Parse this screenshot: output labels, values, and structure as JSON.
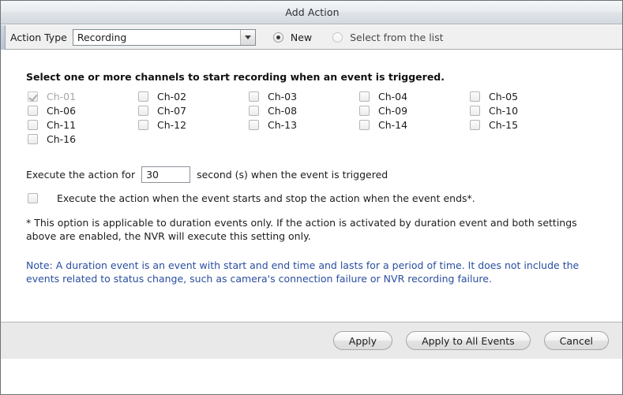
{
  "window": {
    "title": "Add Action"
  },
  "toolbar": {
    "action_type_label": "Action Type",
    "action_type_value": "Recording",
    "action_type_options": [
      "Recording"
    ],
    "dropdown_icon": "chevron-down-icon",
    "radio_new": "New",
    "radio_select_from_list": "Select from the list",
    "radio_selected": "New"
  },
  "main": {
    "intro": "Select one or more channels to start recording when an event is triggered.",
    "channels": [
      {
        "label": "Ch-01",
        "checked": true,
        "disabled": true
      },
      {
        "label": "Ch-02",
        "checked": false,
        "disabled": false
      },
      {
        "label": "Ch-03",
        "checked": false,
        "disabled": false
      },
      {
        "label": "Ch-04",
        "checked": false,
        "disabled": false
      },
      {
        "label": "Ch-05",
        "checked": false,
        "disabled": false
      },
      {
        "label": "Ch-06",
        "checked": false,
        "disabled": false
      },
      {
        "label": "Ch-07",
        "checked": false,
        "disabled": false
      },
      {
        "label": "Ch-08",
        "checked": false,
        "disabled": false
      },
      {
        "label": "Ch-09",
        "checked": false,
        "disabled": false
      },
      {
        "label": "Ch-10",
        "checked": false,
        "disabled": false
      },
      {
        "label": "Ch-11",
        "checked": false,
        "disabled": false
      },
      {
        "label": "Ch-12",
        "checked": false,
        "disabled": false
      },
      {
        "label": "Ch-13",
        "checked": false,
        "disabled": false
      },
      {
        "label": "Ch-14",
        "checked": false,
        "disabled": false
      },
      {
        "label": "Ch-15",
        "checked": false,
        "disabled": false
      },
      {
        "label": "Ch-16",
        "checked": false,
        "disabled": false
      }
    ],
    "duration_prefix": "Execute the action for",
    "duration_value": "30",
    "duration_suffix": "second (s) when the event is triggered",
    "start_stop_checkbox_label": "Execute the action when the event starts and stop the action when the event ends*.",
    "start_stop_checked": false,
    "footnote": "* This option is applicable to duration events only. If the action is activated by duration event and both settings above are enabled, the NVR will execute this setting only.",
    "note": "Note: A duration event is an event with start and end time and lasts for a period of time. It does not include the events related to status change, such as camera's connection failure or NVR recording failure.",
    "note_color": "#2a4ea0"
  },
  "footer": {
    "apply": "Apply",
    "apply_all": "Apply to All Events",
    "cancel": "Cancel"
  }
}
